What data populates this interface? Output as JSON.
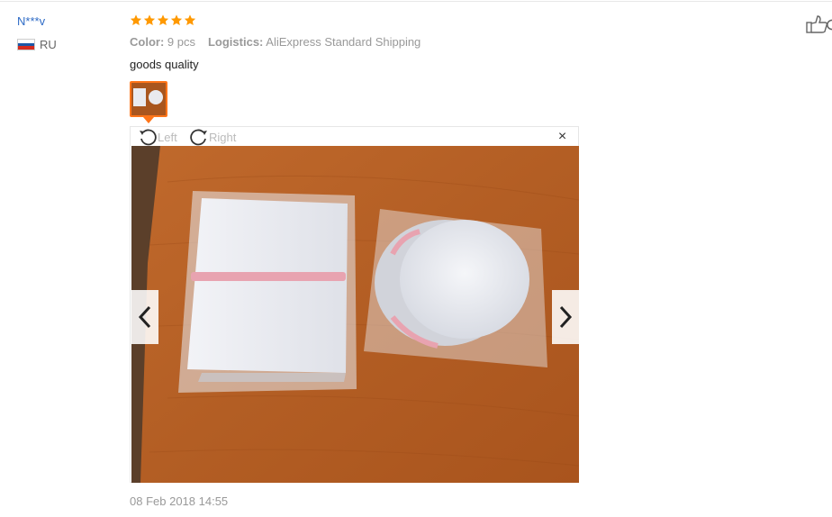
{
  "reviewer": {
    "name": "N***v",
    "country": "RU",
    "flag_colors": [
      "#ffffff",
      "#1c57a7",
      "#d52b1e"
    ]
  },
  "rating": {
    "stars": 5,
    "max": 5,
    "color": "#ff9900"
  },
  "meta": {
    "color_label": "Color:",
    "color_value": "9 pcs",
    "logistics_label": "Logistics:",
    "logistics_value": "AliExpress Standard Shipping"
  },
  "review": {
    "text": "goods quality"
  },
  "viewer": {
    "rotate_left_label": "Left",
    "rotate_right_label": "Right",
    "close_glyph": "×",
    "prev_icon": "chevron-left-icon",
    "next_icon": "chevron-right-icon"
  },
  "date": "08 Feb 2018 14:55",
  "colors": {
    "accent": "#ff7519",
    "link": "#2e6bc6",
    "muted": "#999999"
  }
}
